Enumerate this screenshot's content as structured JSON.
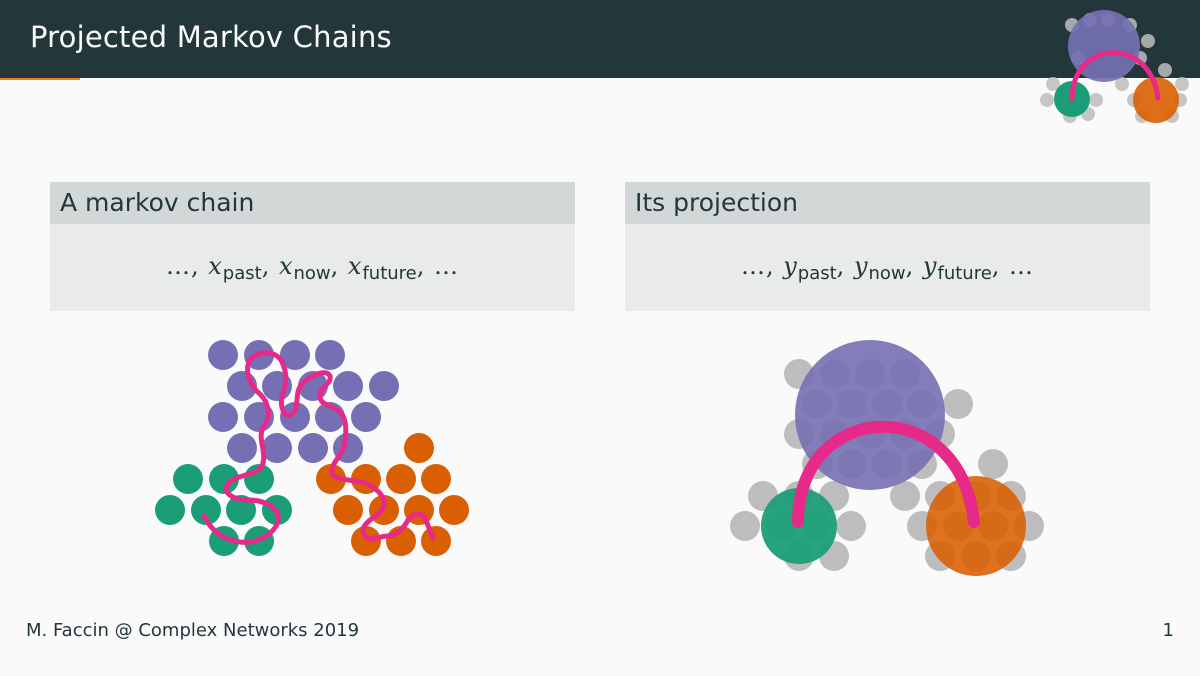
{
  "header": {
    "title": "Projected Markov Chains"
  },
  "left_block": {
    "title": "A markov chain",
    "formula": {
      "dots": "…",
      "var": "x",
      "subs": [
        "past",
        "now",
        "future"
      ]
    }
  },
  "right_block": {
    "title": "Its projection",
    "formula": {
      "dots": "…",
      "var": "y",
      "subs": [
        "past",
        "now",
        "future"
      ]
    }
  },
  "footer": {
    "author": "M. Faccin @ Complex Networks 2019",
    "page": "1"
  },
  "colors": {
    "bar": "#23373b",
    "purple": "#7570b3",
    "green": "#1b9e77",
    "orange": "#d95f02",
    "path": "#e7298a",
    "grey": "#bdbdbd"
  }
}
